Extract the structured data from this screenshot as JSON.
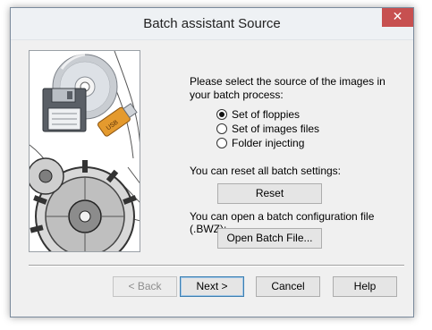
{
  "window": {
    "title": "Batch assistant Source",
    "close_glyph": "✕"
  },
  "content": {
    "prompt": "Please select the source of the images in your batch process:",
    "sources": [
      {
        "label": "Set of floppies",
        "selected": true
      },
      {
        "label": "Set of images files",
        "selected": false
      },
      {
        "label": "Folder injecting",
        "selected": false
      }
    ],
    "reset_prompt": "You can reset all batch settings:",
    "reset_button": "Reset",
    "open_prompt": "You can open a batch configuration file (.BWZ):",
    "open_button": "Open Batch File..."
  },
  "footer": {
    "back_button": "< Back",
    "next_button": "Next >",
    "cancel_button": "Cancel",
    "help_button": "Help"
  },
  "artwork": {
    "usb_label": "USB"
  },
  "colors": {
    "close_button": "#c75050",
    "default_button_border": "#3c7fb1",
    "floppy": "#5a5f66",
    "usb_body": "#e49a2e"
  }
}
